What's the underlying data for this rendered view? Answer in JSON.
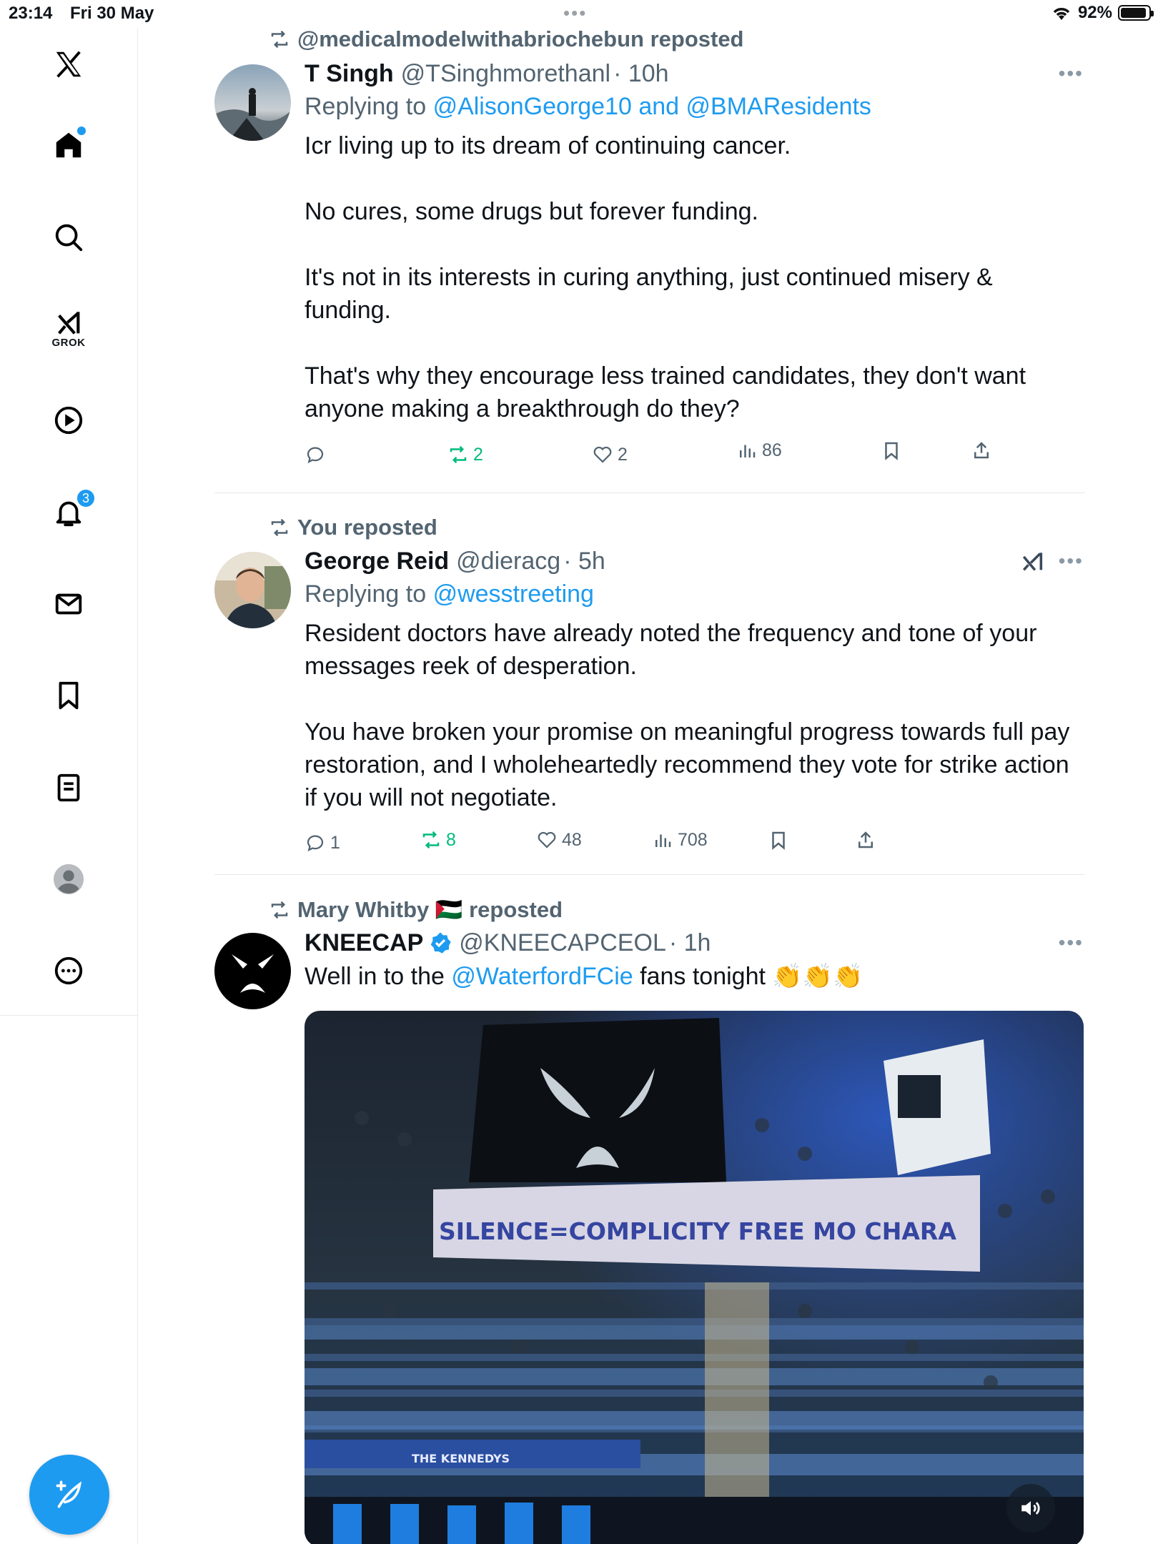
{
  "status_bar": {
    "time": "23:14",
    "date": "Fri 30 May",
    "battery": "92%",
    "battery_level": 0.92
  },
  "sidebar": {
    "grok_label": "GROK",
    "notifications_count": "3"
  },
  "posts": [
    {
      "repost_text": "@medicalmodelwithabriochebun reposted",
      "name": "T Singh",
      "handle": "@TSinghmorethanl",
      "time": "· 10h",
      "replying_prefix": "Replying to",
      "replying_mentions": "@AlisonGeorge10 and @BMAResidents",
      "paragraphs": [
        "Icr living up to its dream of continuing cancer.",
        "No cures, some drugs but forever funding.",
        "It's not in its interests in curing anything, just continued misery & funding.",
        "That's why they encourage less trained candidates, they don't want anyone making a breakthrough do they?"
      ],
      "replies": "",
      "reposts": "2",
      "likes": "2",
      "views": "86"
    },
    {
      "repost_text": "You reposted",
      "name": "George Reid",
      "handle": "@dieracg",
      "time": "· 5h",
      "replying_prefix": "Replying to",
      "replying_mentions": "@wesstreeting",
      "paragraphs": [
        "Resident doctors have already noted the frequency and tone of your messages reek of desperation.",
        "You have broken your promise on meaningful progress towards full pay restoration, and I wholeheartedly recommend they vote for strike action if you will not negotiate."
      ],
      "replies": "1",
      "reposts": "8",
      "likes": "48",
      "views": "708"
    },
    {
      "repost_text": "Mary Whitby 🇵🇸 reposted",
      "name": "KNEECAP",
      "handle": "@KNEECAPCEOL",
      "time": "· 1h",
      "text_before": "Well in to the ",
      "text_link": "@WaterfordFCie",
      "text_after": " fans tonight 👏👏👏",
      "banner_text": "SILENCE=COMPLICITY FREE MO CHARA",
      "ad_board_text": "THE KENNEDYS"
    }
  ]
}
